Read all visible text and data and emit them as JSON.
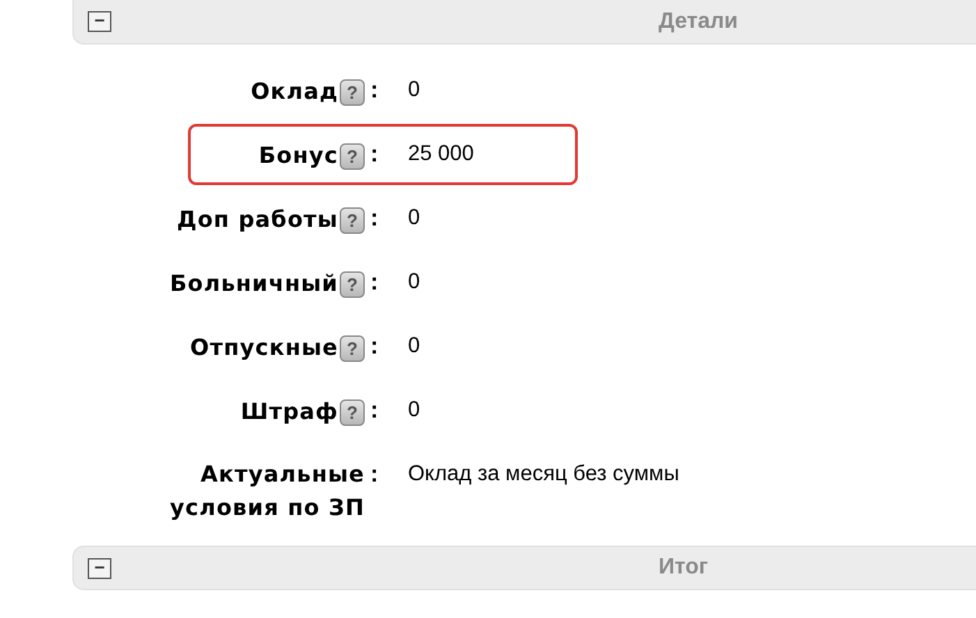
{
  "sections": [
    {
      "title": "Детали",
      "expanded": true,
      "collapse_icon": "−",
      "rows": [
        {
          "label": "Оклад",
          "help": "?",
          "value": "0",
          "highlighted": false
        },
        {
          "label": "Бонус",
          "help": "?",
          "value": "25 000",
          "highlighted": true
        },
        {
          "label": "Доп работы",
          "help": "?",
          "value": "0",
          "highlighted": false
        },
        {
          "label": "Больничный",
          "help": "?",
          "value": "0",
          "highlighted": false
        },
        {
          "label": "Отпускные",
          "help": "?",
          "value": "0",
          "highlighted": false
        },
        {
          "label": "Штраф",
          "help": "?",
          "value": "0",
          "highlighted": false
        },
        {
          "label": "Актуальные условия по ЗП",
          "value": "Оклад за месяц без суммы",
          "highlighted": false
        }
      ]
    },
    {
      "title": "Итог",
      "expanded": true,
      "collapse_icon": "−"
    }
  ],
  "colon": ":"
}
